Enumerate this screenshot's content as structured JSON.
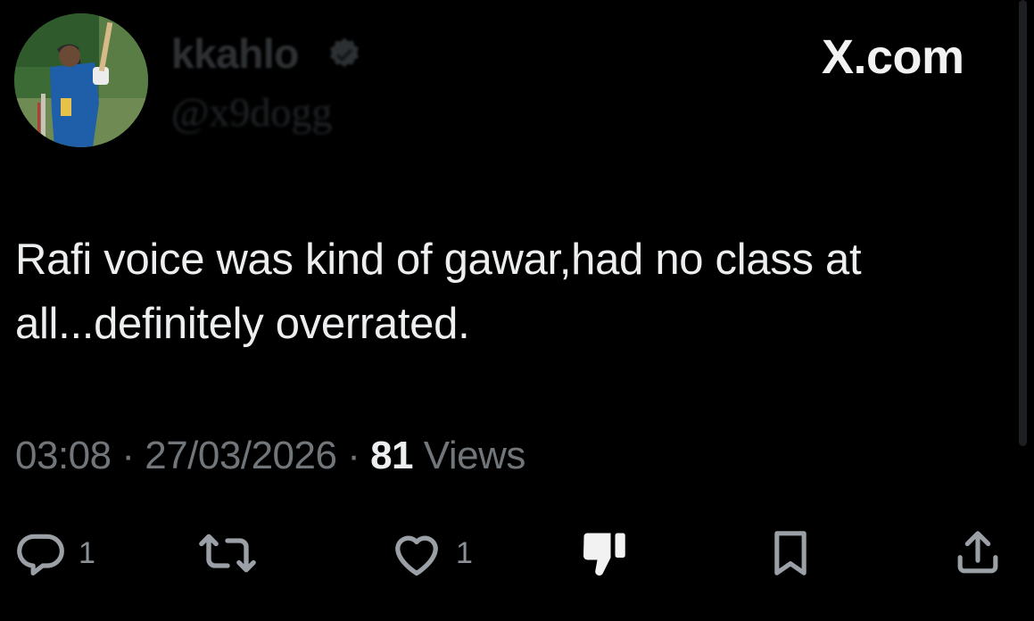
{
  "user": {
    "display_name": "kkahlo",
    "handle": "@x9dogg",
    "verified": true
  },
  "brand": "X.com",
  "tweet": {
    "text": "Rafi voice was kind of gawar,had no class at all...definitely overrated."
  },
  "meta": {
    "time": "03:08",
    "separator": "·",
    "date": "27/03/2026",
    "views_count": "81",
    "views_label": "Views"
  },
  "actions": {
    "replies": "1",
    "likes": "1"
  },
  "icons": {
    "reply": "reply-icon",
    "retweet": "retweet-icon",
    "like": "heart-icon",
    "dislike": "thumbs-down-icon",
    "bookmark": "bookmark-icon",
    "share": "share-icon",
    "verified": "verified-badge-icon"
  },
  "colors": {
    "background": "#000000",
    "text_primary": "#eceeef",
    "text_secondary": "#71767b"
  }
}
